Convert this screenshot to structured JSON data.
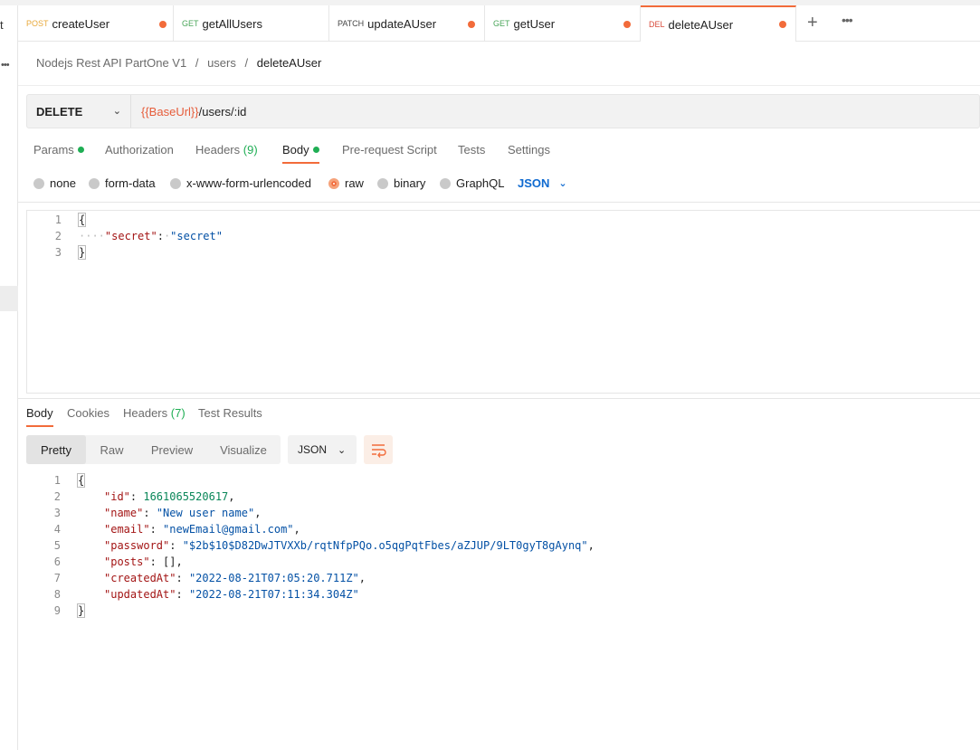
{
  "left_rail": {
    "partial_label": "t",
    "more": "•••"
  },
  "tabs": [
    {
      "method": "POST",
      "name": "createUser"
    },
    {
      "method": "GET",
      "name": "getAllUsers"
    },
    {
      "method": "PATCH",
      "name": "updateAUser"
    },
    {
      "method": "GET",
      "name": "getUser"
    },
    {
      "method": "DEL",
      "name": "deleteAUser"
    }
  ],
  "tab_add": "+",
  "tab_more": "•••",
  "breadcrumb": {
    "collection": "Nodejs Rest API PartOne V1",
    "folder": "users",
    "request": "deleteAUser",
    "sep": "/"
  },
  "request": {
    "method": "DELETE",
    "url_var": "{{BaseUrl}}",
    "url_path": "/users/:id"
  },
  "request_tabs": [
    {
      "label": "Params"
    },
    {
      "label": "Authorization"
    },
    {
      "label": "Headers",
      "count": "(9)"
    },
    {
      "label": "Body"
    },
    {
      "label": "Pre-request Script"
    },
    {
      "label": "Tests"
    },
    {
      "label": "Settings"
    }
  ],
  "body_types": [
    "none",
    "form-data",
    "x-www-form-urlencoded",
    "raw",
    "binary",
    "GraphQL"
  ],
  "body_format": "JSON",
  "request_body": {
    "line_numbers": [
      "1",
      "2",
      "3"
    ],
    "open": "{",
    "key": "\"secret\"",
    "value": "\"secret\"",
    "close": "}"
  },
  "response_tabs": [
    {
      "label": "Body"
    },
    {
      "label": "Cookies"
    },
    {
      "label": "Headers",
      "count": "(7)"
    },
    {
      "label": "Test Results"
    }
  ],
  "response_views": [
    "Pretty",
    "Raw",
    "Preview",
    "Visualize"
  ],
  "response_format": "JSON",
  "response_body": {
    "line_numbers": [
      "1",
      "2",
      "3",
      "4",
      "5",
      "6",
      "7",
      "8",
      "9"
    ],
    "open": "{",
    "close": "}",
    "fields": [
      {
        "key": "\"id\"",
        "value": "1661065520617",
        "type": "number"
      },
      {
        "key": "\"name\"",
        "value": "\"New user name\"",
        "type": "string"
      },
      {
        "key": "\"email\"",
        "value": "\"newEmail@gmail.com\"",
        "type": "string"
      },
      {
        "key": "\"password\"",
        "value": "\"$2b$10$D82DwJTVXXb/rqtNfpPQo.o5qgPqtFbes/aZJUP/9LT0gyT8gAynq\"",
        "type": "string"
      },
      {
        "key": "\"posts\"",
        "value": "[]",
        "type": "plain"
      },
      {
        "key": "\"createdAt\"",
        "value": "\"2022-08-21T07:05:20.711Z\"",
        "type": "string"
      },
      {
        "key": "\"updatedAt\"",
        "value": "\"2022-08-21T07:11:34.304Z\"",
        "type": "string"
      }
    ]
  }
}
